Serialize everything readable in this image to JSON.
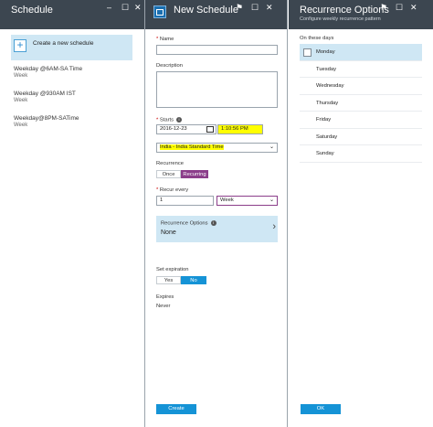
{
  "blade1": {
    "title": "Schedule",
    "create_label": "Create a new schedule",
    "schedules": [
      {
        "name": "Weekday @6AM-SA Time",
        "freq": "Week"
      },
      {
        "name": "Weekday @930AM IST",
        "freq": "Week"
      },
      {
        "name": "Weekday@8PM-SATime",
        "freq": "Week"
      }
    ]
  },
  "blade2": {
    "title": "New Schedule",
    "name_label": "Name",
    "name_value": "",
    "description_label": "Description",
    "description_value": "",
    "starts_label": "Starts",
    "start_date": "2016-12-23",
    "start_time": "1:10:56 PM",
    "timezone": "India - India Standard Time",
    "recurrence_label": "Recurrence",
    "recurrence_options": [
      "Once",
      "Recurring"
    ],
    "recurrence_selected": "Recurring",
    "recur_every_label": "Recur every",
    "recur_every_value": "1",
    "recur_unit": "Week",
    "recurrence_options_label": "Recurrence Options",
    "recurrence_options_value": "None",
    "set_expiration_label": "Set expiration",
    "expiration_options": [
      "Yes",
      "No"
    ],
    "expiration_selected": "No",
    "expires_label": "Expires",
    "expires_value": "Never",
    "create_button": "Create"
  },
  "blade3": {
    "title": "Recurrence Options",
    "subtitle": "Configure weekly recurrence pattern",
    "days_label": "On these days",
    "days": [
      "Monday",
      "Tuesday",
      "Wednesday",
      "Thursday",
      "Friday",
      "Saturday",
      "Sunday"
    ],
    "ok_button": "OK"
  },
  "colors": {
    "header_bg": "#3c4650",
    "accent_blue": "#1593d6",
    "light_blue": "#cfe7f4",
    "purple": "#8b3e8a",
    "highlight": "#ffff00"
  }
}
